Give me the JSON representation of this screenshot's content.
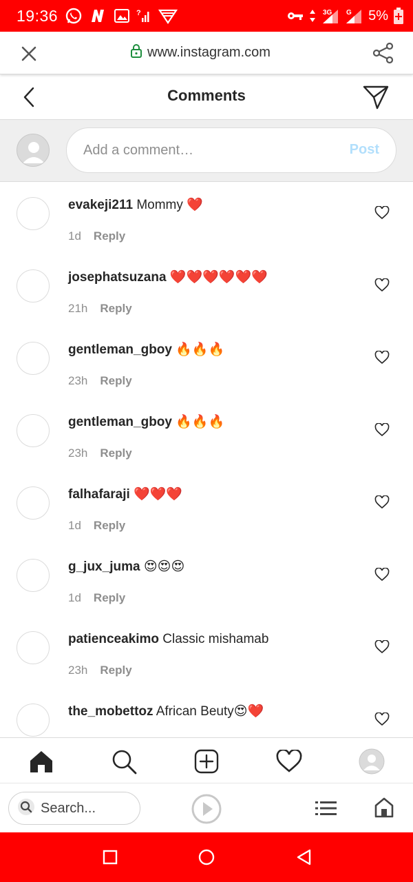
{
  "status_bar": {
    "time": "19:36",
    "battery": "5%",
    "network_3g": "3G",
    "network_g": "G"
  },
  "browser": {
    "url": "www.instagram.com"
  },
  "header": {
    "title": "Comments"
  },
  "add_comment": {
    "placeholder": "Add a comment…",
    "post_label": "Post"
  },
  "comments": [
    {
      "user": "evakeji211",
      "text": "Mommy ❤️",
      "time": "1d",
      "reply": "Reply"
    },
    {
      "user": "josephatsuzana",
      "text": "❤️❤️❤️❤️❤️❤️",
      "time": "21h",
      "reply": "Reply"
    },
    {
      "user": "gentleman_gboy",
      "text": "🔥🔥🔥",
      "time": "23h",
      "reply": "Reply"
    },
    {
      "user": "gentleman_gboy",
      "text": "🔥🔥🔥",
      "time": "23h",
      "reply": "Reply"
    },
    {
      "user": "falhafaraji",
      "text": "❤️❤️❤️",
      "time": "1d",
      "reply": "Reply"
    },
    {
      "user": "g_jux_juma",
      "text": "😍😍😍",
      "time": "1d",
      "reply": "Reply"
    },
    {
      "user": "patienceakimo",
      "text": "Classic mishamab",
      "time": "23h",
      "reply": "Reply"
    },
    {
      "user": "the_mobettoz",
      "text": "African Beuty😍❤️",
      "time": "",
      "reply": ""
    }
  ],
  "browser_bottom": {
    "search_placeholder": "Search..."
  },
  "colors": {
    "system_red": "#ff0000",
    "post_disabled": "#b2dffc",
    "muted_text": "#8e8e8e"
  }
}
